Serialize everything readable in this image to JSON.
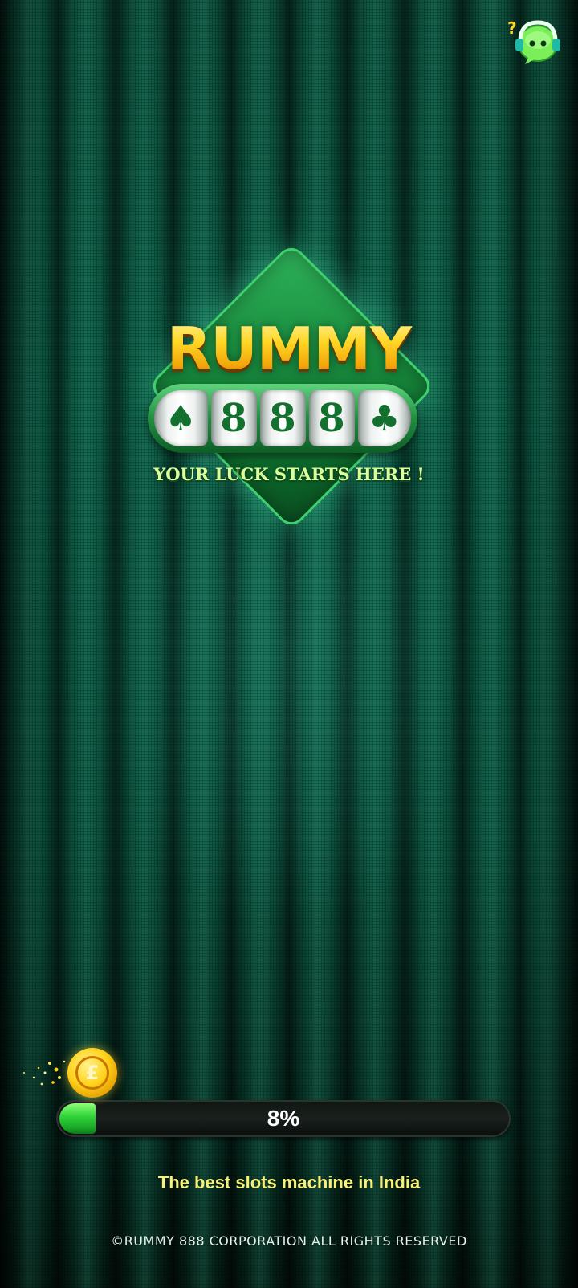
{
  "logo": {
    "title": "RUMMY",
    "reels": [
      "♠",
      "8",
      "8",
      "8",
      "♣"
    ],
    "tagline": "YOUR LUCK STARTS HERE !"
  },
  "support": {
    "icon": "support-headset-icon"
  },
  "loader": {
    "progress_label": "8%",
    "progress_fraction": 0.08,
    "coin_icon": "coin-icon"
  },
  "subtitle": "The best slots machine in India",
  "footer": {
    "copyright": "©RUMMY 888 CORPORATION ALL RIGHTS RESERVED"
  },
  "colors": {
    "background": "#0b4a38",
    "progress_fill": "#34d63c",
    "subtitle": "#f7f07a",
    "logo_gold": "#ffd21c"
  }
}
